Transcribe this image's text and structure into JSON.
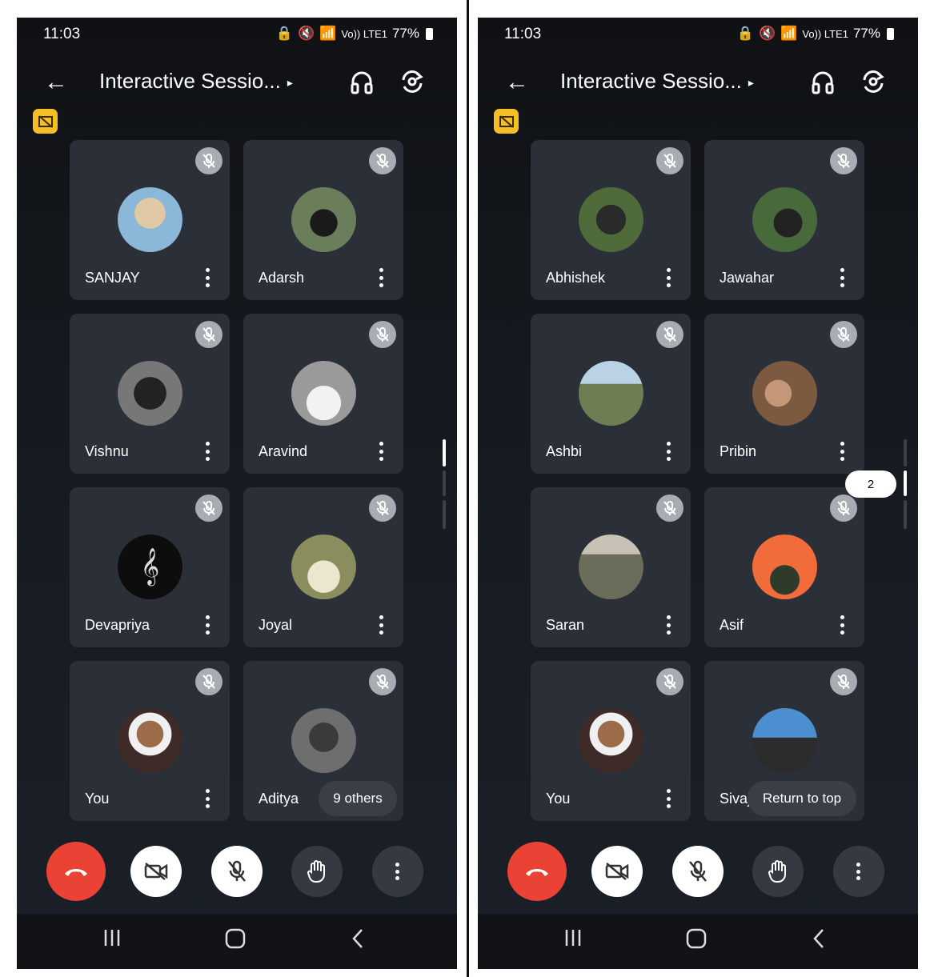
{
  "status": {
    "time": "11:03",
    "battery": "77%",
    "net": "Vo)) LTE1"
  },
  "meeting": {
    "title": "Interactive Sessio...",
    "caret": "▸"
  },
  "left_panel": {
    "participants": [
      {
        "name": "SANJAY",
        "avatar_color": "#8bb7d8"
      },
      {
        "name": "Adarsh",
        "avatar_color": "#6b7e5b"
      },
      {
        "name": "Vishnu",
        "avatar_color": "#555555"
      },
      {
        "name": "Aravind",
        "avatar_color": "#9a9a9a"
      },
      {
        "name": "Devapriya",
        "avatar_color": "#0d0d0d"
      },
      {
        "name": "Joyal",
        "avatar_color": "#8a8d5e"
      },
      {
        "name": "You",
        "avatar_color": "#7a4a3e"
      },
      {
        "name": "Aditya",
        "avatar_color": "#6e6e6e"
      }
    ],
    "others_label": "9 others"
  },
  "right_panel": {
    "participants": [
      {
        "name": "Abhishek",
        "avatar_color": "#4f6b3a"
      },
      {
        "name": "Jawahar",
        "avatar_color": "#486a3a"
      },
      {
        "name": "Ashbi",
        "avatar_color": "#7b8e9b"
      },
      {
        "name": "Pribin",
        "avatar_color": "#7c5a40"
      },
      {
        "name": "Saran",
        "avatar_color": "#6a6d5a"
      },
      {
        "name": "Asif",
        "avatar_color": "#f26b3a"
      },
      {
        "name": "You",
        "avatar_color": "#7a4a3e"
      },
      {
        "name": "Sivaj",
        "avatar_color": "#4b8fd0"
      }
    ],
    "return_label": "Return to top",
    "page_indicator": "2"
  },
  "colors": {
    "end_call": "#ea4335",
    "badge": "#f6bf26",
    "tile": "#2b3038"
  }
}
